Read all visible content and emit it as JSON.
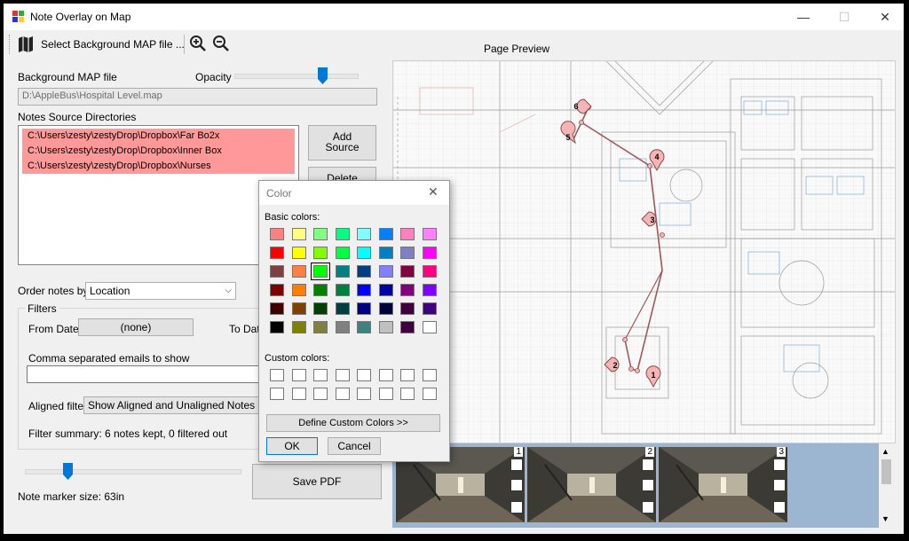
{
  "window": {
    "title": "Note Overlay on Map",
    "minimize": "—",
    "maximize": "☐",
    "close": "✕"
  },
  "toolbar": {
    "select_map_label": "Select Background MAP file ...",
    "zoom_in_icon": "zoom-in-icon",
    "zoom_out_icon": "zoom-out-icon"
  },
  "left": {
    "bg_map_label": "Background MAP file",
    "opacity_label": "Opacity",
    "opacity_value": 0.72,
    "map_path": "D:\\AppleBus\\Hospital Level.map",
    "notes_dirs_label": "Notes Source Directories",
    "notes_dirs": [
      "C:\\Users\\zesty\\zestyDrop\\Dropbox\\Far Bo2x",
      "C:\\Users\\zesty\\zestyDrop\\Dropbox\\Inner Box",
      "C:\\Users\\zesty\\zestyDrop\\Dropbox\\Nurses"
    ],
    "add_source_label": "Add Source",
    "delete_label": "Delete",
    "order_label": "Order notes by",
    "order_value": "Location",
    "filters_label": "Filters",
    "from_date_label": "From Date:",
    "from_date_value": "(none)",
    "to_date_label": "To Date:",
    "emails_label": "Comma separated emails to show",
    "emails_value": "",
    "aligned_label": "Aligned filter:",
    "aligned_value": "Show Aligned and Unaligned Notes",
    "filter_summary": "Filter summary: 6 notes kept, 0 filtered out",
    "marker_size_label": "Note marker size: 63in",
    "marker_size_value": 0.2,
    "save_pdf_label": "Save PDF"
  },
  "preview": {
    "title": "Page Preview",
    "markers": [
      "1",
      "2",
      "3",
      "4",
      "5",
      "6"
    ],
    "thumbnails": [
      {
        "num": "1"
      },
      {
        "num": "2"
      },
      {
        "num": "3"
      }
    ]
  },
  "color_dialog": {
    "title": "Color",
    "basic_label": "Basic colors:",
    "custom_label": "Custom colors:",
    "define_label": "Define Custom Colors >>",
    "ok_label": "OK",
    "cancel_label": "Cancel",
    "basic_colors": [
      "#ff8080",
      "#ffff80",
      "#80ff80",
      "#00ff80",
      "#80ffff",
      "#0080ff",
      "#ff80c0",
      "#ff80ff",
      "#ff0000",
      "#ffff00",
      "#80ff00",
      "#00ff40",
      "#00ffff",
      "#0080c0",
      "#8080c0",
      "#ff00ff",
      "#804040",
      "#ff8040",
      "#00ff00",
      "#008080",
      "#004080",
      "#8080ff",
      "#800040",
      "#ff0080",
      "#800000",
      "#ff8000",
      "#008000",
      "#008040",
      "#0000ff",
      "#0000a0",
      "#800080",
      "#8000ff",
      "#400000",
      "#804000",
      "#004000",
      "#004040",
      "#000080",
      "#000040",
      "#400040",
      "#400080",
      "#000000",
      "#808000",
      "#808040",
      "#808080",
      "#408080",
      "#c0c0c0",
      "#400040",
      "#ffffff"
    ],
    "selected_index": 18
  }
}
